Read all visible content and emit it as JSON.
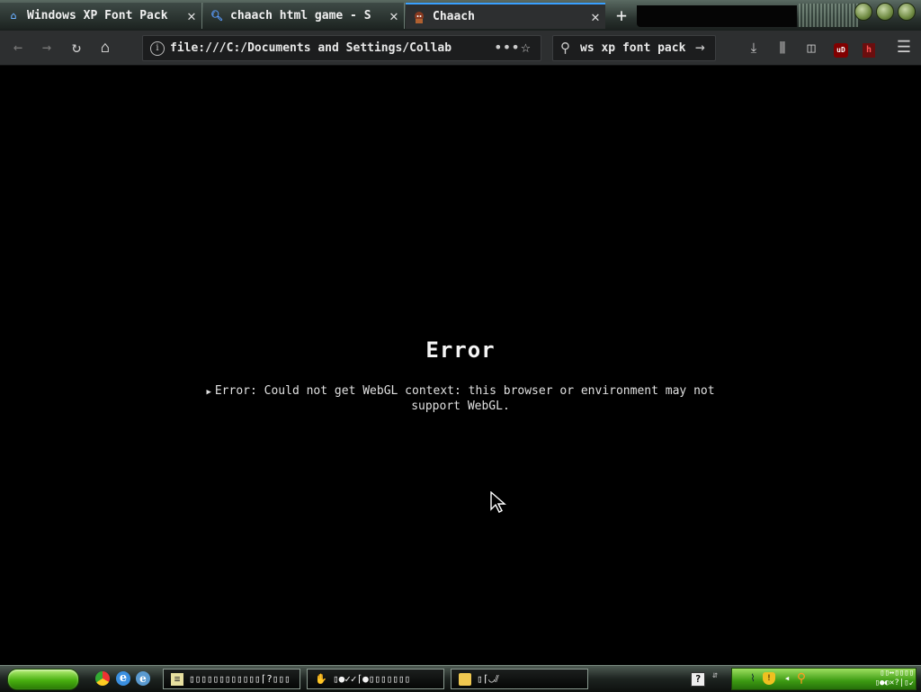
{
  "browser": {
    "tabs": [
      {
        "label": "Windows XP Font Pack",
        "icon": "home-page-icon"
      },
      {
        "label": "chaach html game - S",
        "icon": "search-icon"
      },
      {
        "label": "Chaach",
        "icon": "game-favicon",
        "active": true
      }
    ],
    "new_tab_glyph": "+",
    "url": "file:///C:/Documents and Settings/Collab",
    "search_value": "ws xp font pack",
    "accent_color": "#39a0ff"
  },
  "toolbar": {
    "ublock_label": "uD",
    "ext_label": "h"
  },
  "page": {
    "error_title": "Error",
    "error_message": "Error: Could not get WebGL context: this browser or environment may not support WebGL."
  },
  "taskbar": {
    "tasks": [
      {
        "label": "▯▯▯▯▯▯▯▯▯▯▯▯⌈?▯▯▯",
        "icon": "notepad-icon"
      },
      {
        "label": "▯●✓✓⌈●▯▯▯▯▯▯▯",
        "icon": "handshake-icon"
      },
      {
        "label": "▯⌈◡⫽",
        "icon": "folder-icon"
      }
    ],
    "help_label": "?",
    "tray_text_line1": "▯▯↔▯▯▯▯",
    "tray_text_line2": "▯●◐✕?|▯↙",
    "start_color": "#48b010"
  }
}
